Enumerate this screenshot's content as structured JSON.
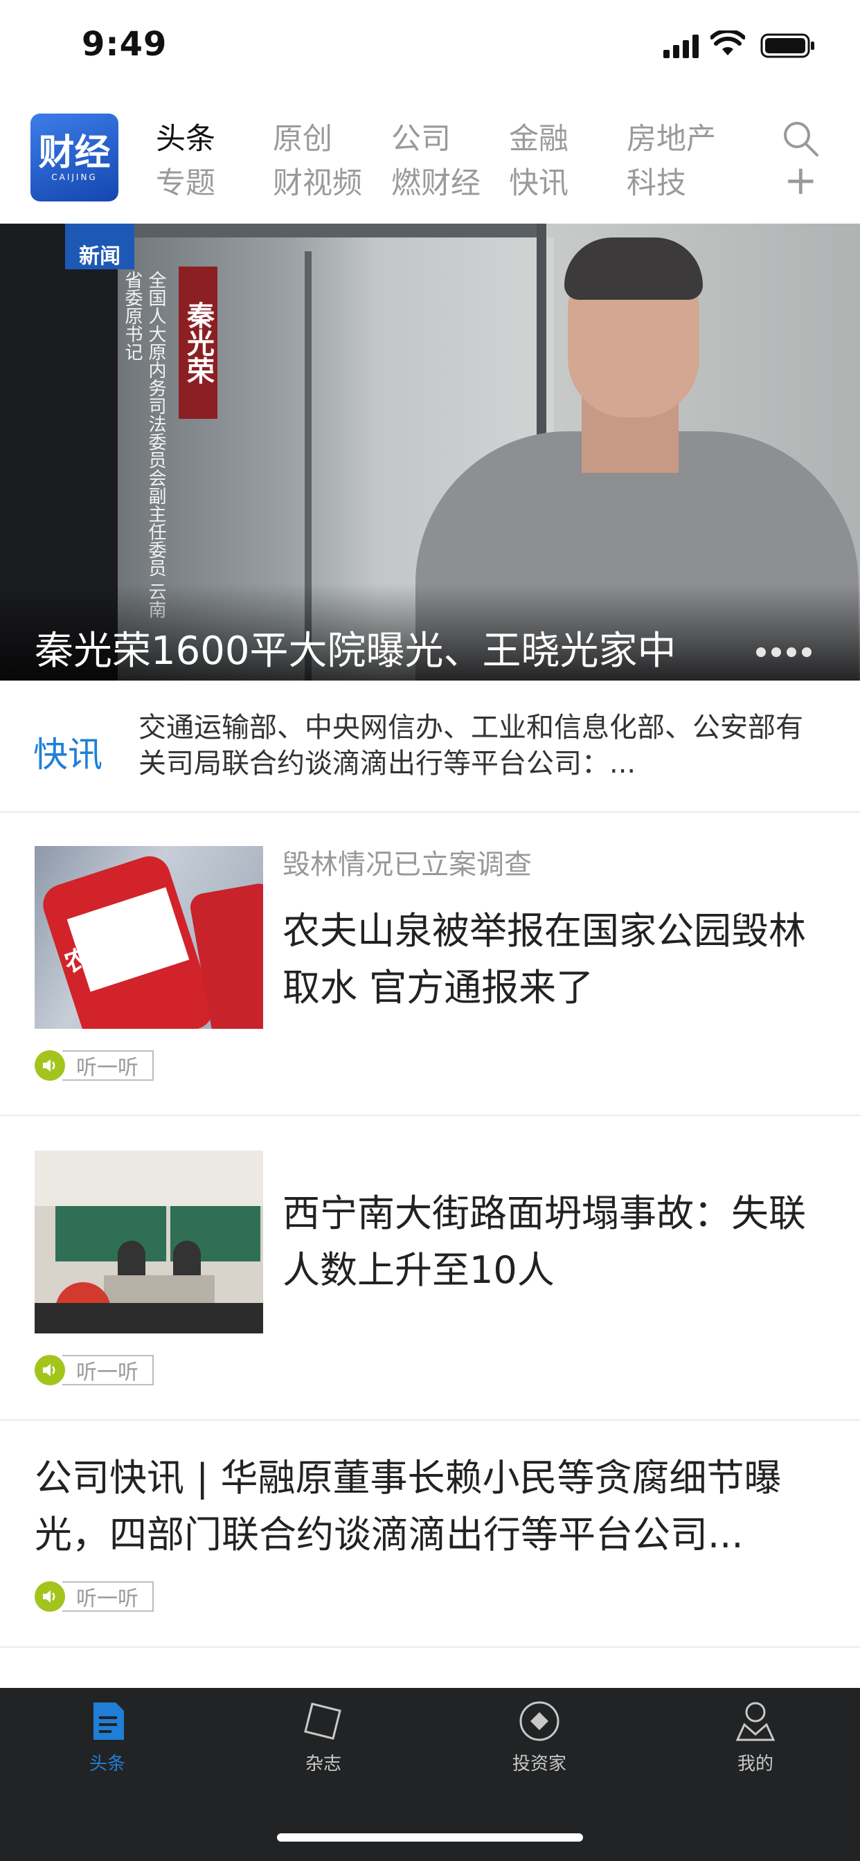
{
  "status_bar": {
    "time": "9:49"
  },
  "header": {
    "logo_text": "财经",
    "logo_sub": "CAIJING",
    "nav_top": [
      "头条",
      "原创",
      "公司",
      "金融",
      "房地产"
    ],
    "nav_bottom": [
      "专题",
      "财视频",
      "燃财经",
      "快讯",
      "科技"
    ],
    "active_tab": "头条"
  },
  "hero": {
    "title": "秦光荣1600平大院曝光、王晓光家中",
    "name_tag": "秦光荣",
    "caption": "全国人大原内务司法委员会副主任委员 云南省委原书记",
    "logo_overlay": "新闻"
  },
  "flash": {
    "label": "快讯",
    "text": "交通运输部、中央网信办、工业和信息化部、公安部有关司局联合约谈滴滴出行等平台公司：..."
  },
  "news": [
    {
      "subtitle": "毁林情况已立案调查",
      "headline": "农夫山泉被举报在国家公园毁林取水 官方通报来了",
      "listen": "听一听",
      "thumb_text": "农夫山泉"
    },
    {
      "subtitle": "",
      "headline": "西宁南大街路面坍塌事故：失联人数上升至10人",
      "listen": "听一听"
    },
    {
      "subtitle": "",
      "headline": "公司快讯 | 华融原董事长赖小民等贪腐细节曝光，四部门联合约谈滴滴出行等平台公司...",
      "listen": "听一听"
    }
  ],
  "tabbar": [
    {
      "label": "头条",
      "icon": "news-doc-icon",
      "active": true
    },
    {
      "label": "杂志",
      "icon": "magazine-icon",
      "active": false
    },
    {
      "label": "投资家",
      "icon": "investor-icon",
      "active": false
    },
    {
      "label": "我的",
      "icon": "profile-icon",
      "active": false
    }
  ],
  "colors": {
    "accent": "#1f7fd6",
    "listen_green": "#a3c41d",
    "tabbar_bg": "#222324"
  }
}
